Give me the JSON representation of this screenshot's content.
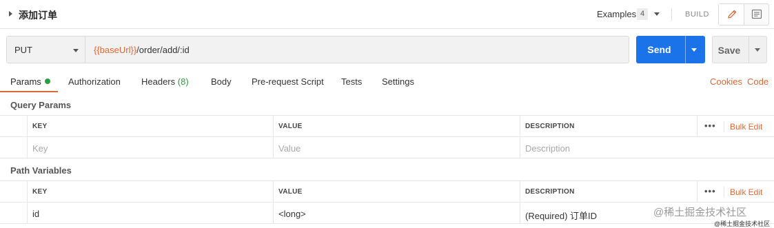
{
  "header": {
    "title": "添加订单",
    "examples_label": "Examples",
    "examples_count": "4",
    "build_label": "BUILD"
  },
  "request": {
    "method": "PUT",
    "url_var": "{{baseUrl}}",
    "url_path": "/order/add/:id",
    "send_label": "Send",
    "save_label": "Save"
  },
  "tabs": [
    {
      "label": "Params"
    },
    {
      "label": "Authorization"
    },
    {
      "label": "Headers",
      "badge": "(8)"
    },
    {
      "label": "Body"
    },
    {
      "label": "Pre-request Script"
    },
    {
      "label": "Tests"
    },
    {
      "label": "Settings"
    }
  ],
  "links": {
    "cookies": "Cookies",
    "code": "Code"
  },
  "query_params": {
    "title": "Query Params",
    "columns": [
      "KEY",
      "VALUE",
      "DESCRIPTION"
    ],
    "bulk_edit": "Bulk Edit",
    "placeholder": {
      "key": "Key",
      "value": "Value",
      "description": "Description"
    }
  },
  "path_variables": {
    "title": "Path Variables",
    "columns": [
      "KEY",
      "VALUE",
      "DESCRIPTION"
    ],
    "bulk_edit": "Bulk Edit",
    "rows": [
      {
        "key": "id",
        "value": "<long>",
        "description": "(Required) 订单ID"
      }
    ]
  },
  "watermark": {
    "main": "@稀土掘金技术社区",
    "small": "@稀土掘金技术社区"
  },
  "colors": {
    "accent": "#e06733",
    "send": "#1a73e8",
    "active_dot": "#2a9d3d"
  }
}
